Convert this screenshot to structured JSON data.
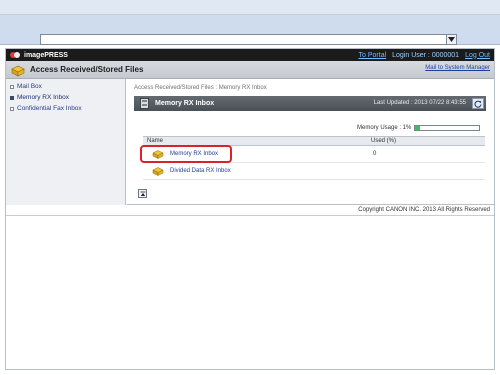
{
  "app": {
    "brand_name": "imagePRESS",
    "to_portal": "To Portal",
    "login_user": "Login User : 0000001",
    "logout": "Log Out",
    "page_title": "Access Received/Stored Files",
    "system_manager_link": "Mail to System Manager"
  },
  "sidebar": {
    "items": [
      {
        "label": "Mail Box",
        "active": false
      },
      {
        "label": "Memory RX Inbox",
        "active": true
      },
      {
        "label": "Confidential Fax Inbox",
        "active": false
      }
    ]
  },
  "main": {
    "breadcrumb": "Access Received/Stored Files : Memory RX Inbox",
    "panel_title": "Memory RX Inbox",
    "last_updated": "Last Updated : 2013 07/22 8:43:55",
    "memory_usage_label": "Memory Usage : 1%",
    "memory_usage_percent": 1,
    "table": {
      "headers": [
        "Name",
        "Used (%)"
      ],
      "rows": [
        {
          "name": "Memory RX Inbox",
          "used": "0"
        },
        {
          "name": "Divided Data RX Inbox",
          "used": ""
        }
      ]
    }
  },
  "footer": {
    "copyright": "Copyright CANON INC. 2013 All Rights Reserved"
  },
  "colors": {
    "brand_bar": "#1b1b1b",
    "link": "#1f3f9c",
    "highlight": "#d92329",
    "usage_fill": "#36c35f"
  }
}
